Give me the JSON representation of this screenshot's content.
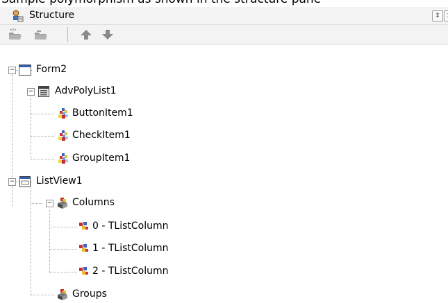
{
  "caption": "Sample polymorphism as shown in the structure pane",
  "panel": {
    "title": "Structure",
    "pin_glyph": "‡",
    "close_glyph": "×"
  },
  "toolbar": {
    "buttons": [
      {
        "icon": "folder-expand-icon"
      },
      {
        "icon": "folder-collapse-icon"
      },
      {
        "icon": "arrow-up-icon"
      },
      {
        "icon": "arrow-down-icon"
      }
    ]
  },
  "tree": [
    {
      "label": "Form2",
      "icon": "form-window-icon",
      "expanded": true
    },
    {
      "label": "AdvPolyList1",
      "icon": "list-control-icon",
      "expanded": true
    },
    {
      "label": "ButtonItem1",
      "icon": "poly-item-icon"
    },
    {
      "label": "CheckItem1",
      "icon": "poly-item-icon"
    },
    {
      "label": "GroupItem1",
      "icon": "poly-item-icon"
    },
    {
      "label": "ListView1",
      "icon": "listview-icon",
      "expanded": true
    },
    {
      "label": "Columns",
      "icon": "collection-icon",
      "expanded": true
    },
    {
      "label": "0 - TListColumn",
      "icon": "column-item-icon"
    },
    {
      "label": "1 - TListColumn",
      "icon": "column-item-icon"
    },
    {
      "label": "2 - TListColumn",
      "icon": "column-item-icon"
    },
    {
      "label": "Groups",
      "icon": "collection-icon"
    }
  ],
  "colors": {
    "panel_bg": "#f3f3f3",
    "tree_bg": "#ffffff",
    "arrow": "#8a8a8a"
  }
}
